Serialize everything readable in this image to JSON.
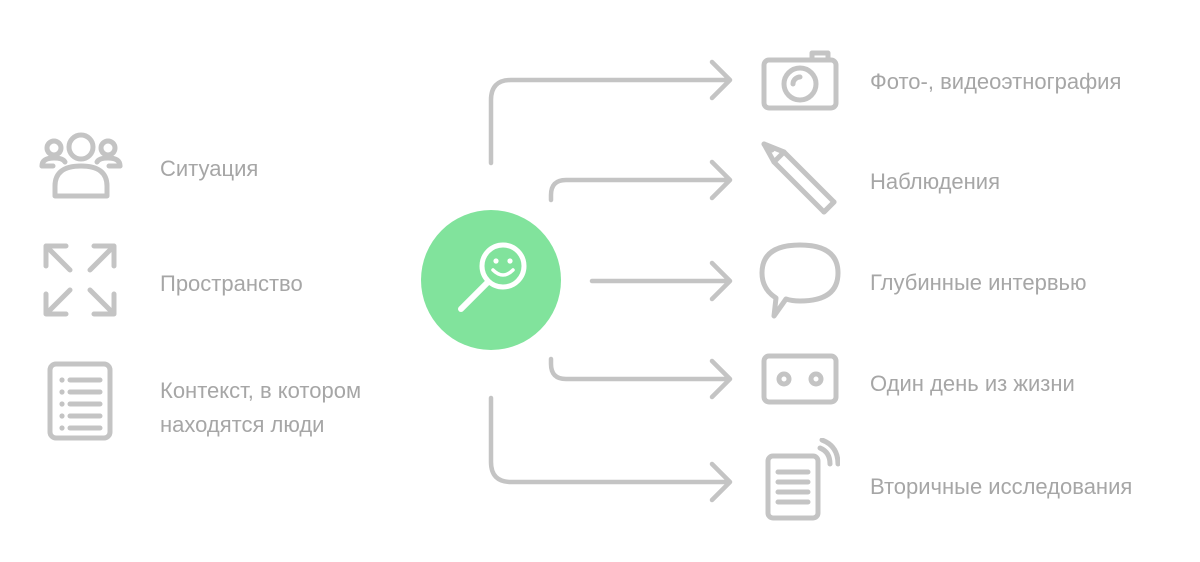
{
  "colors": {
    "accent": "#81e39c",
    "icon_gray": "#c4c4c4",
    "text_gray": "#a6a6a6"
  },
  "left_items": [
    {
      "icon": "people-group-icon",
      "label": "Ситуация"
    },
    {
      "icon": "expand-arrows-icon",
      "label": "Пространство"
    },
    {
      "icon": "list-document-icon",
      "label_line1": "Контекст, в котором",
      "label_line2": "находятся люди"
    }
  ],
  "center": {
    "icon": "smiley-magnifier-icon"
  },
  "right_items": [
    {
      "icon": "camera-icon",
      "label": "Фото-, видеоэтнография"
    },
    {
      "icon": "pen-icon",
      "label": "Наблюдения"
    },
    {
      "icon": "speech-bubble-icon",
      "label": "Глубинные интервью"
    },
    {
      "icon": "cassette-icon",
      "label": "Один день из жизни"
    },
    {
      "icon": "document-signal-icon",
      "label": "Вторичные исследования"
    }
  ]
}
